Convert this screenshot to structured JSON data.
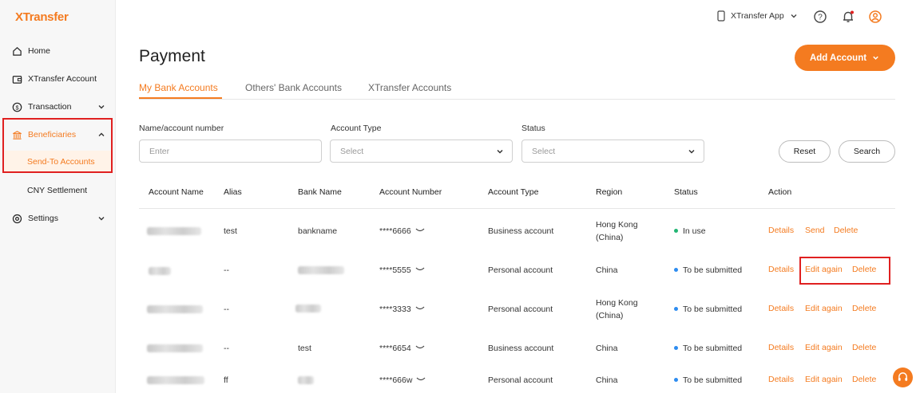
{
  "brand": {
    "logo": "XTransfer",
    "accent": "#f47b20"
  },
  "sidebar": {
    "items": [
      {
        "label": "Home",
        "icon": "home-icon"
      },
      {
        "label": "XTransfer Account",
        "icon": "wallet-icon"
      },
      {
        "label": "Transaction",
        "icon": "dollar-circle-icon"
      },
      {
        "label": "Beneficiaries",
        "icon": "bank-icon"
      },
      {
        "label": "Send-To Accounts"
      },
      {
        "label": "CNY Settlement"
      },
      {
        "label": "Settings",
        "icon": "gear-icon"
      }
    ]
  },
  "topbar": {
    "app_label": "XTransfer App"
  },
  "page": {
    "title": "Payment",
    "add_button": "Add Account"
  },
  "tabs": [
    "My Bank Accounts",
    "Others' Bank Accounts",
    "XTransfer Accounts"
  ],
  "filters": {
    "name_label": "Name/account number",
    "name_placeholder": "Enter",
    "type_label": "Account Type",
    "type_value": "Select",
    "status_label": "Status",
    "status_value": "Select",
    "reset": "Reset",
    "search": "Search"
  },
  "table": {
    "headers": [
      "Account Name",
      "Alias",
      "Bank Name",
      "Account Number",
      "Account Type",
      "Region",
      "Status",
      "Action"
    ],
    "rows": [
      {
        "alias": "test",
        "bank": "bankname",
        "number": "****6666",
        "type": "Business account",
        "region_1": "Hong Kong",
        "region_2": "(China)",
        "status": "In use",
        "status_color": "#22b573",
        "actions": [
          "Details",
          "Send",
          "Delete"
        ]
      },
      {
        "alias": "--",
        "bank": "",
        "number": "****5555",
        "type": "Personal account",
        "region_1": "China",
        "region_2": "",
        "status": "To be submitted",
        "status_color": "#2d8cf0",
        "actions": [
          "Details",
          "Edit again",
          "Delete"
        ]
      },
      {
        "alias": "--",
        "bank": "",
        "number": "****3333",
        "type": "Personal account",
        "region_1": "Hong Kong",
        "region_2": "(China)",
        "status": "To be submitted",
        "status_color": "#2d8cf0",
        "actions": [
          "Details",
          "Edit again",
          "Delete"
        ]
      },
      {
        "alias": "--",
        "bank": "test",
        "number": "****6654",
        "type": "Business account",
        "region_1": "China",
        "region_2": "",
        "status": "To be submitted",
        "status_color": "#2d8cf0",
        "actions": [
          "Details",
          "Edit again",
          "Delete"
        ]
      },
      {
        "alias": "ff",
        "bank": "",
        "number": "****666w",
        "type": "Personal account",
        "region_1": "China",
        "region_2": "",
        "status": "To be submitted",
        "status_color": "#2d8cf0",
        "actions": [
          "Details",
          "Edit again",
          "Delete"
        ]
      }
    ]
  }
}
